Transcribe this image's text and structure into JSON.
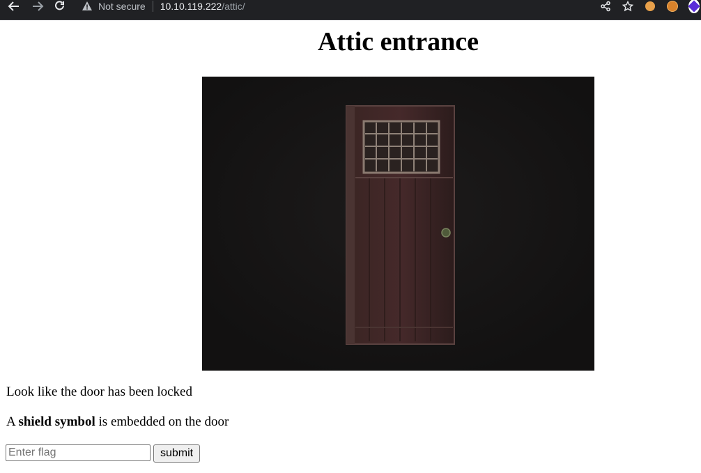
{
  "browser": {
    "security_label": "Not secure",
    "url_host": "10.10.119.222",
    "url_path": "/attic/"
  },
  "page": {
    "title": "Attic entrance",
    "image_alt": "door",
    "line1": "Look like the door has been locked",
    "line2_prefix": "A ",
    "line2_bold": "shield symbol",
    "line2_suffix": " is embedded on the door",
    "flag_placeholder": "Enter flag",
    "submit_label": "submit"
  },
  "colors": {
    "chrome_bg": "#202124",
    "image_bg": "#151414",
    "door": "#3a2220"
  }
}
